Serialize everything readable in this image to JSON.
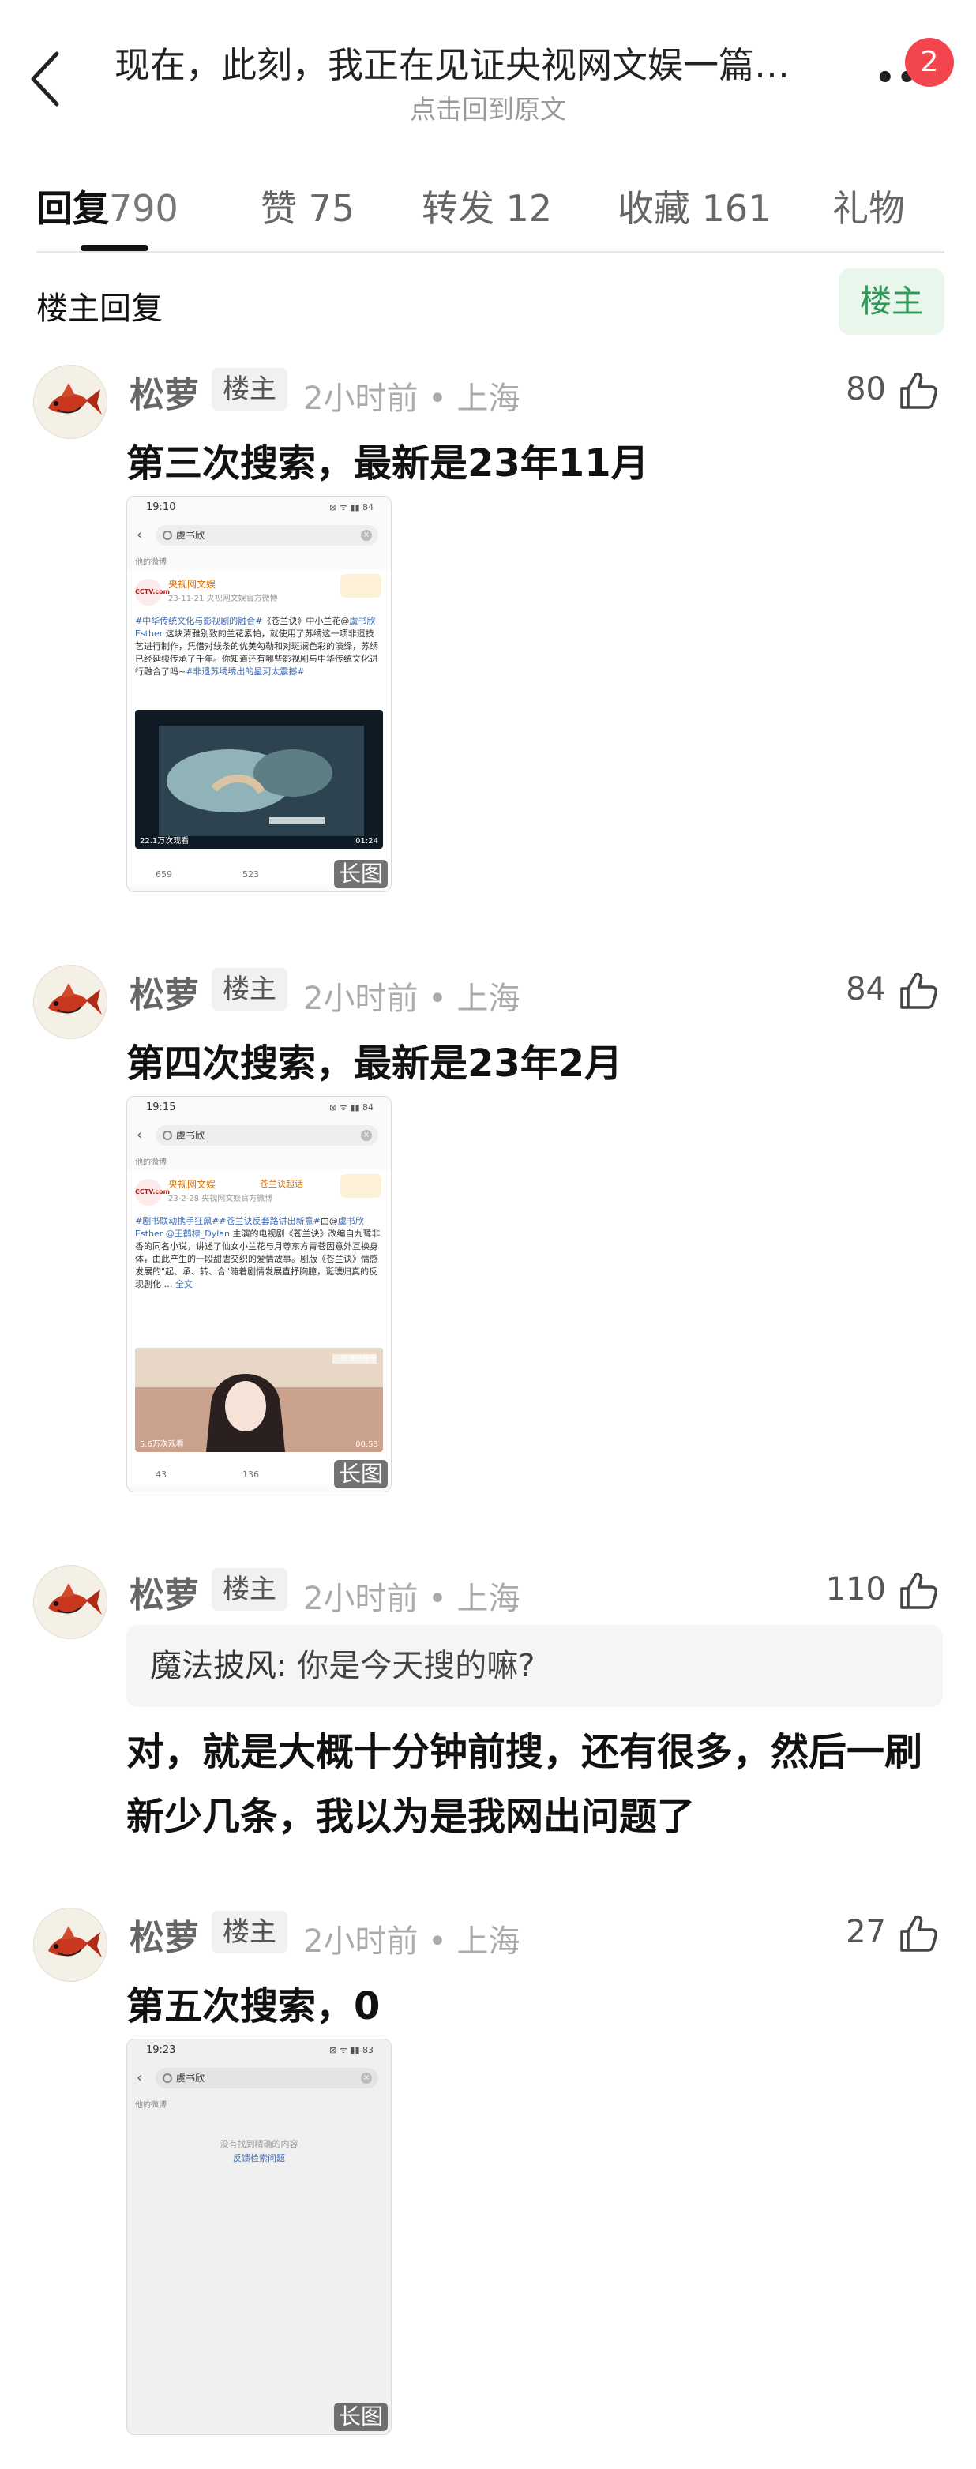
{
  "header": {
    "title": "现在，此刻，我正在见证央视网文娱一篇…",
    "subtitle": "点击回到原文",
    "more_label": "••",
    "notification_count": "2"
  },
  "tabs": [
    {
      "label": "回复",
      "count": "790",
      "active": true
    },
    {
      "label": "赞",
      "count": "75"
    },
    {
      "label": "转发",
      "count": "12"
    },
    {
      "label": "收藏",
      "count": "161"
    },
    {
      "label": "礼物",
      "count": ""
    }
  ],
  "section": {
    "title": "楼主回复",
    "filter_label": "楼主"
  },
  "comments": [
    {
      "name": "松萝",
      "tag": "楼主",
      "meta": "2小时前 • 上海",
      "likes": "80",
      "text": "第三次搜索，最新是23年11月",
      "screenshot": {
        "time": "19:10",
        "status_icons": "⊠ ᯤ ▮▮ 84",
        "query": "虞书欣",
        "section": "他的微博",
        "author": "央视网文娱",
        "avatar_text": "CCTV.com",
        "date": "23-11-21 央视网文娱官方微博",
        "desc_link1": "#中华传统文化与影视剧的融合#",
        "desc_text1": "《苍兰诀》中小兰花@",
        "desc_link2": "虞书欣Esther",
        "desc_text2": " 这块清雅别致的兰花素帕，就使用了苏绣这一项非遗技艺进行制作，凭借对线条的优美勾勒和对斑斓色彩的演绎，苏绣已经延续传承了千年。你知道还有哪些影视剧与中华传统文化进行融合了吗~",
        "desc_link3": "#非遗苏绣绣出的星河太震撼#",
        "video_views": "22.1万次观看",
        "video_duration": "01:24",
        "reposts": "659",
        "comments": "523",
        "long_label": "长图"
      }
    },
    {
      "name": "松萝",
      "tag": "楼主",
      "meta": "2小时前 • 上海",
      "likes": "84",
      "text": "第四次搜索，最新是23年2月",
      "screenshot": {
        "time": "19:15",
        "status_icons": "⊠ ᯤ ▮▮ 84",
        "query": "虞书欣",
        "section": "他的微博",
        "author": "央视网文娱",
        "topic": "苍兰诀超话",
        "avatar_text": "CCTV.com",
        "date": "23-2-28 央视网文娱官方微博",
        "desc_link1": "#剧书联动携手狂飙##苍兰诀反套路讲出新意#",
        "desc_text1": "由@",
        "desc_link2": "虞书欣Esther @王鹤棣_Dylan",
        "desc_text2": " 主演的电视剧《苍兰诀》改编自九鹭非香的同名小说，讲述了仙女小兰花与月尊东方青苍因意外互换身体，由此产生的一段甜虐交织的爱情故事。剧版《苍兰诀》情感发展的\"起、承、转、合\"随着剧情发展直抒胸臆，诞璞归真的反现剧化 … ",
        "desc_link3": "全文",
        "video_views": "5.6万次观看",
        "video_duration": "00:53",
        "watermark": "微博视频号",
        "reposts": "43",
        "comments": "136",
        "long_label": "长图"
      }
    },
    {
      "name": "松萝",
      "tag": "楼主",
      "meta": "2小时前 • 上海",
      "likes": "110",
      "quote_name": "魔法披风:",
      "quote_text": " 你是今天搜的嘛?",
      "text": "对，就是大概十分钟前搜，还有很多，然后一刷新少几条，我以为是我网出问题了"
    },
    {
      "name": "松萝",
      "tag": "楼主",
      "meta": "2小时前 • 上海",
      "likes": "27",
      "text": "第五次搜索，0",
      "screenshot": {
        "time": "19:23",
        "status_icons": "⊠ ᯤ ▮▮ 83",
        "query": "虞书欣",
        "section": "他的微博",
        "empty_text": "没有找到精确的内容",
        "feedback_link": "反馈检索问题",
        "long_label": "长图"
      }
    }
  ],
  "colors": {
    "accent_green": "#2f9a57",
    "badge_red": "#f2454d",
    "link_blue": "#3a6ab6"
  }
}
